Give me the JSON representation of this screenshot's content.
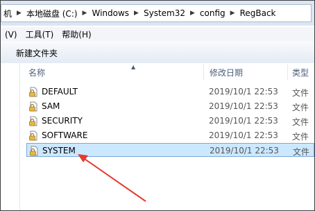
{
  "address_bar": {
    "crumbs": [
      "机",
      "本地磁盘 (C:)",
      "Windows",
      "System32",
      "config",
      "RegBack"
    ]
  },
  "menu": {
    "items": [
      "(V)",
      "工具(T)",
      "帮助(H)"
    ]
  },
  "toolbar": {
    "new_folder_label": "新建文件夹"
  },
  "columns": {
    "name": "名称",
    "date_modified": "修改日期",
    "type": "类型"
  },
  "files": [
    {
      "name": "DEFAULT",
      "date": "2019/10/1 22:53",
      "type": "文件"
    },
    {
      "name": "SAM",
      "date": "2019/10/1 22:53",
      "type": "文件"
    },
    {
      "name": "SECURITY",
      "date": "2019/10/1 22:53",
      "type": "文件"
    },
    {
      "name": "SOFTWARE",
      "date": "2019/10/1 22:53",
      "type": "文件"
    },
    {
      "name": "SYSTEM",
      "date": "2019/10/1 22:53",
      "type": "文件",
      "selected": true
    }
  ],
  "colors": {
    "selection_fill": "#cce8ff",
    "selection_border": "#7aa7d6",
    "annotation_arrow": "#e53a2f",
    "header_text": "#4c607a"
  },
  "icons": {
    "file": "locked-file-icon",
    "breadcrumb_separator": "chevron-right-icon",
    "sort": "sort-ascending-icon",
    "annotation": "red-arrow-icon"
  }
}
